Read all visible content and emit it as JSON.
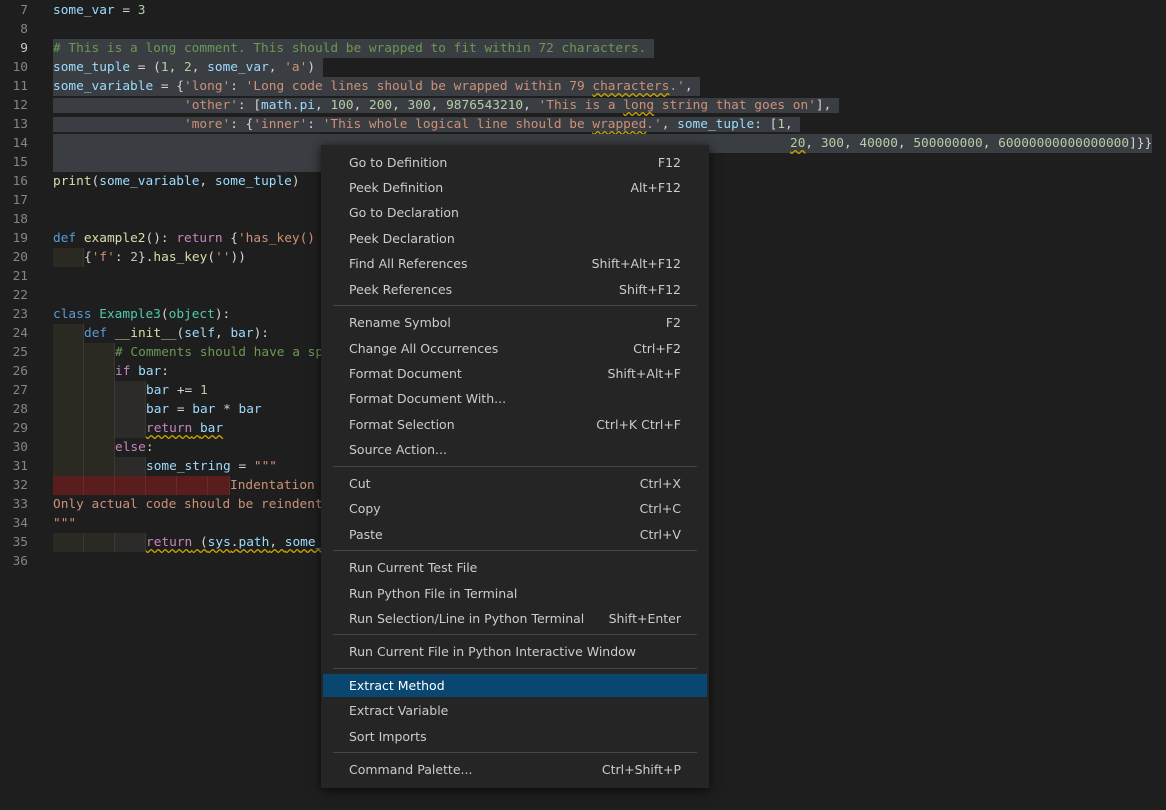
{
  "editor": {
    "lines": [
      {
        "n": "7",
        "text": "some_var = 3"
      },
      {
        "n": "8",
        "text": ""
      },
      {
        "n": "9",
        "text": "# This is a long comment. This should be wrapped to fit within 72 characters."
      },
      {
        "n": "10",
        "text": "some_tuple = (1, 2, some_var, 'a')"
      },
      {
        "n": "11",
        "text": "some_variable = {'long': 'Long code lines should be wrapped within 79 characters.',"
      },
      {
        "n": "12",
        "text": "                 'other': [math.pi, 100, 200, 300, 9876543210, 'This is a long string that goes on'],"
      },
      {
        "n": "13",
        "text": "                 'more': {'inner': 'This whole logical line should be wrapped.', some_tuple: [1,"
      },
      {
        "n": "14",
        "text": "20, 300, 40000, 500000000, 60000000000000000]}}"
      },
      {
        "n": "15",
        "text": ""
      },
      {
        "n": "16",
        "text": "print(some_variable, some_tuple)"
      },
      {
        "n": "17",
        "text": ""
      },
      {
        "n": "18",
        "text": ""
      },
      {
        "n": "19",
        "text": "def example2(): return {'has_key()"
      },
      {
        "n": "20",
        "text": "{'f': 2}.has_key(''))"
      },
      {
        "n": "21",
        "text": ""
      },
      {
        "n": "22",
        "text": ""
      },
      {
        "n": "23",
        "text": "class Example3(object):"
      },
      {
        "n": "24",
        "text": "def __init__(self, bar):"
      },
      {
        "n": "25",
        "text": "# Comments should have a sp"
      },
      {
        "n": "26",
        "text": "if bar:"
      },
      {
        "n": "27",
        "text": "bar += 1"
      },
      {
        "n": "28",
        "text": "bar = bar * bar"
      },
      {
        "n": "29",
        "text": "return bar"
      },
      {
        "n": "30",
        "text": "else:"
      },
      {
        "n": "31",
        "text": "some_string = \"\"\""
      },
      {
        "n": "32",
        "text": "Indentation"
      },
      {
        "n": "33",
        "text": "Only actual code should be reindent"
      },
      {
        "n": "34",
        "text": "\"\"\""
      },
      {
        "n": "35",
        "text": "return (sys.path, some_"
      },
      {
        "n": "36",
        "text": ""
      }
    ]
  },
  "context_menu": {
    "items": [
      {
        "label": "Go to Definition",
        "key": "F12"
      },
      {
        "label": "Peek Definition",
        "key": "Alt+F12"
      },
      {
        "label": "Go to Declaration",
        "key": ""
      },
      {
        "label": "Peek Declaration",
        "key": ""
      },
      {
        "label": "Find All References",
        "key": "Shift+Alt+F12"
      },
      {
        "label": "Peek References",
        "key": "Shift+F12"
      },
      {
        "label": "Rename Symbol",
        "key": "F2"
      },
      {
        "label": "Change All Occurrences",
        "key": "Ctrl+F2"
      },
      {
        "label": "Format Document",
        "key": "Shift+Alt+F"
      },
      {
        "label": "Format Document With...",
        "key": ""
      },
      {
        "label": "Format Selection",
        "key": "Ctrl+K Ctrl+F"
      },
      {
        "label": "Source Action...",
        "key": ""
      },
      {
        "label": "Cut",
        "key": "Ctrl+X"
      },
      {
        "label": "Copy",
        "key": "Ctrl+C"
      },
      {
        "label": "Paste",
        "key": "Ctrl+V"
      },
      {
        "label": "Run Current Test File",
        "key": ""
      },
      {
        "label": "Run Python File in Terminal",
        "key": ""
      },
      {
        "label": "Run Selection/Line in Python Terminal",
        "key": "Shift+Enter"
      },
      {
        "label": "Run Current File in Python Interactive Window",
        "key": ""
      },
      {
        "label": "Extract Method",
        "key": "",
        "highlighted": true
      },
      {
        "label": "Extract Variable",
        "key": ""
      },
      {
        "label": "Sort Imports",
        "key": ""
      },
      {
        "label": "Command Palette...",
        "key": "Ctrl+Shift+P"
      }
    ]
  },
  "colors": {
    "editor_bg": "#1e1e1e",
    "menu_bg": "#252526",
    "menu_highlight": "#094771",
    "selection": "#3a3d41"
  }
}
